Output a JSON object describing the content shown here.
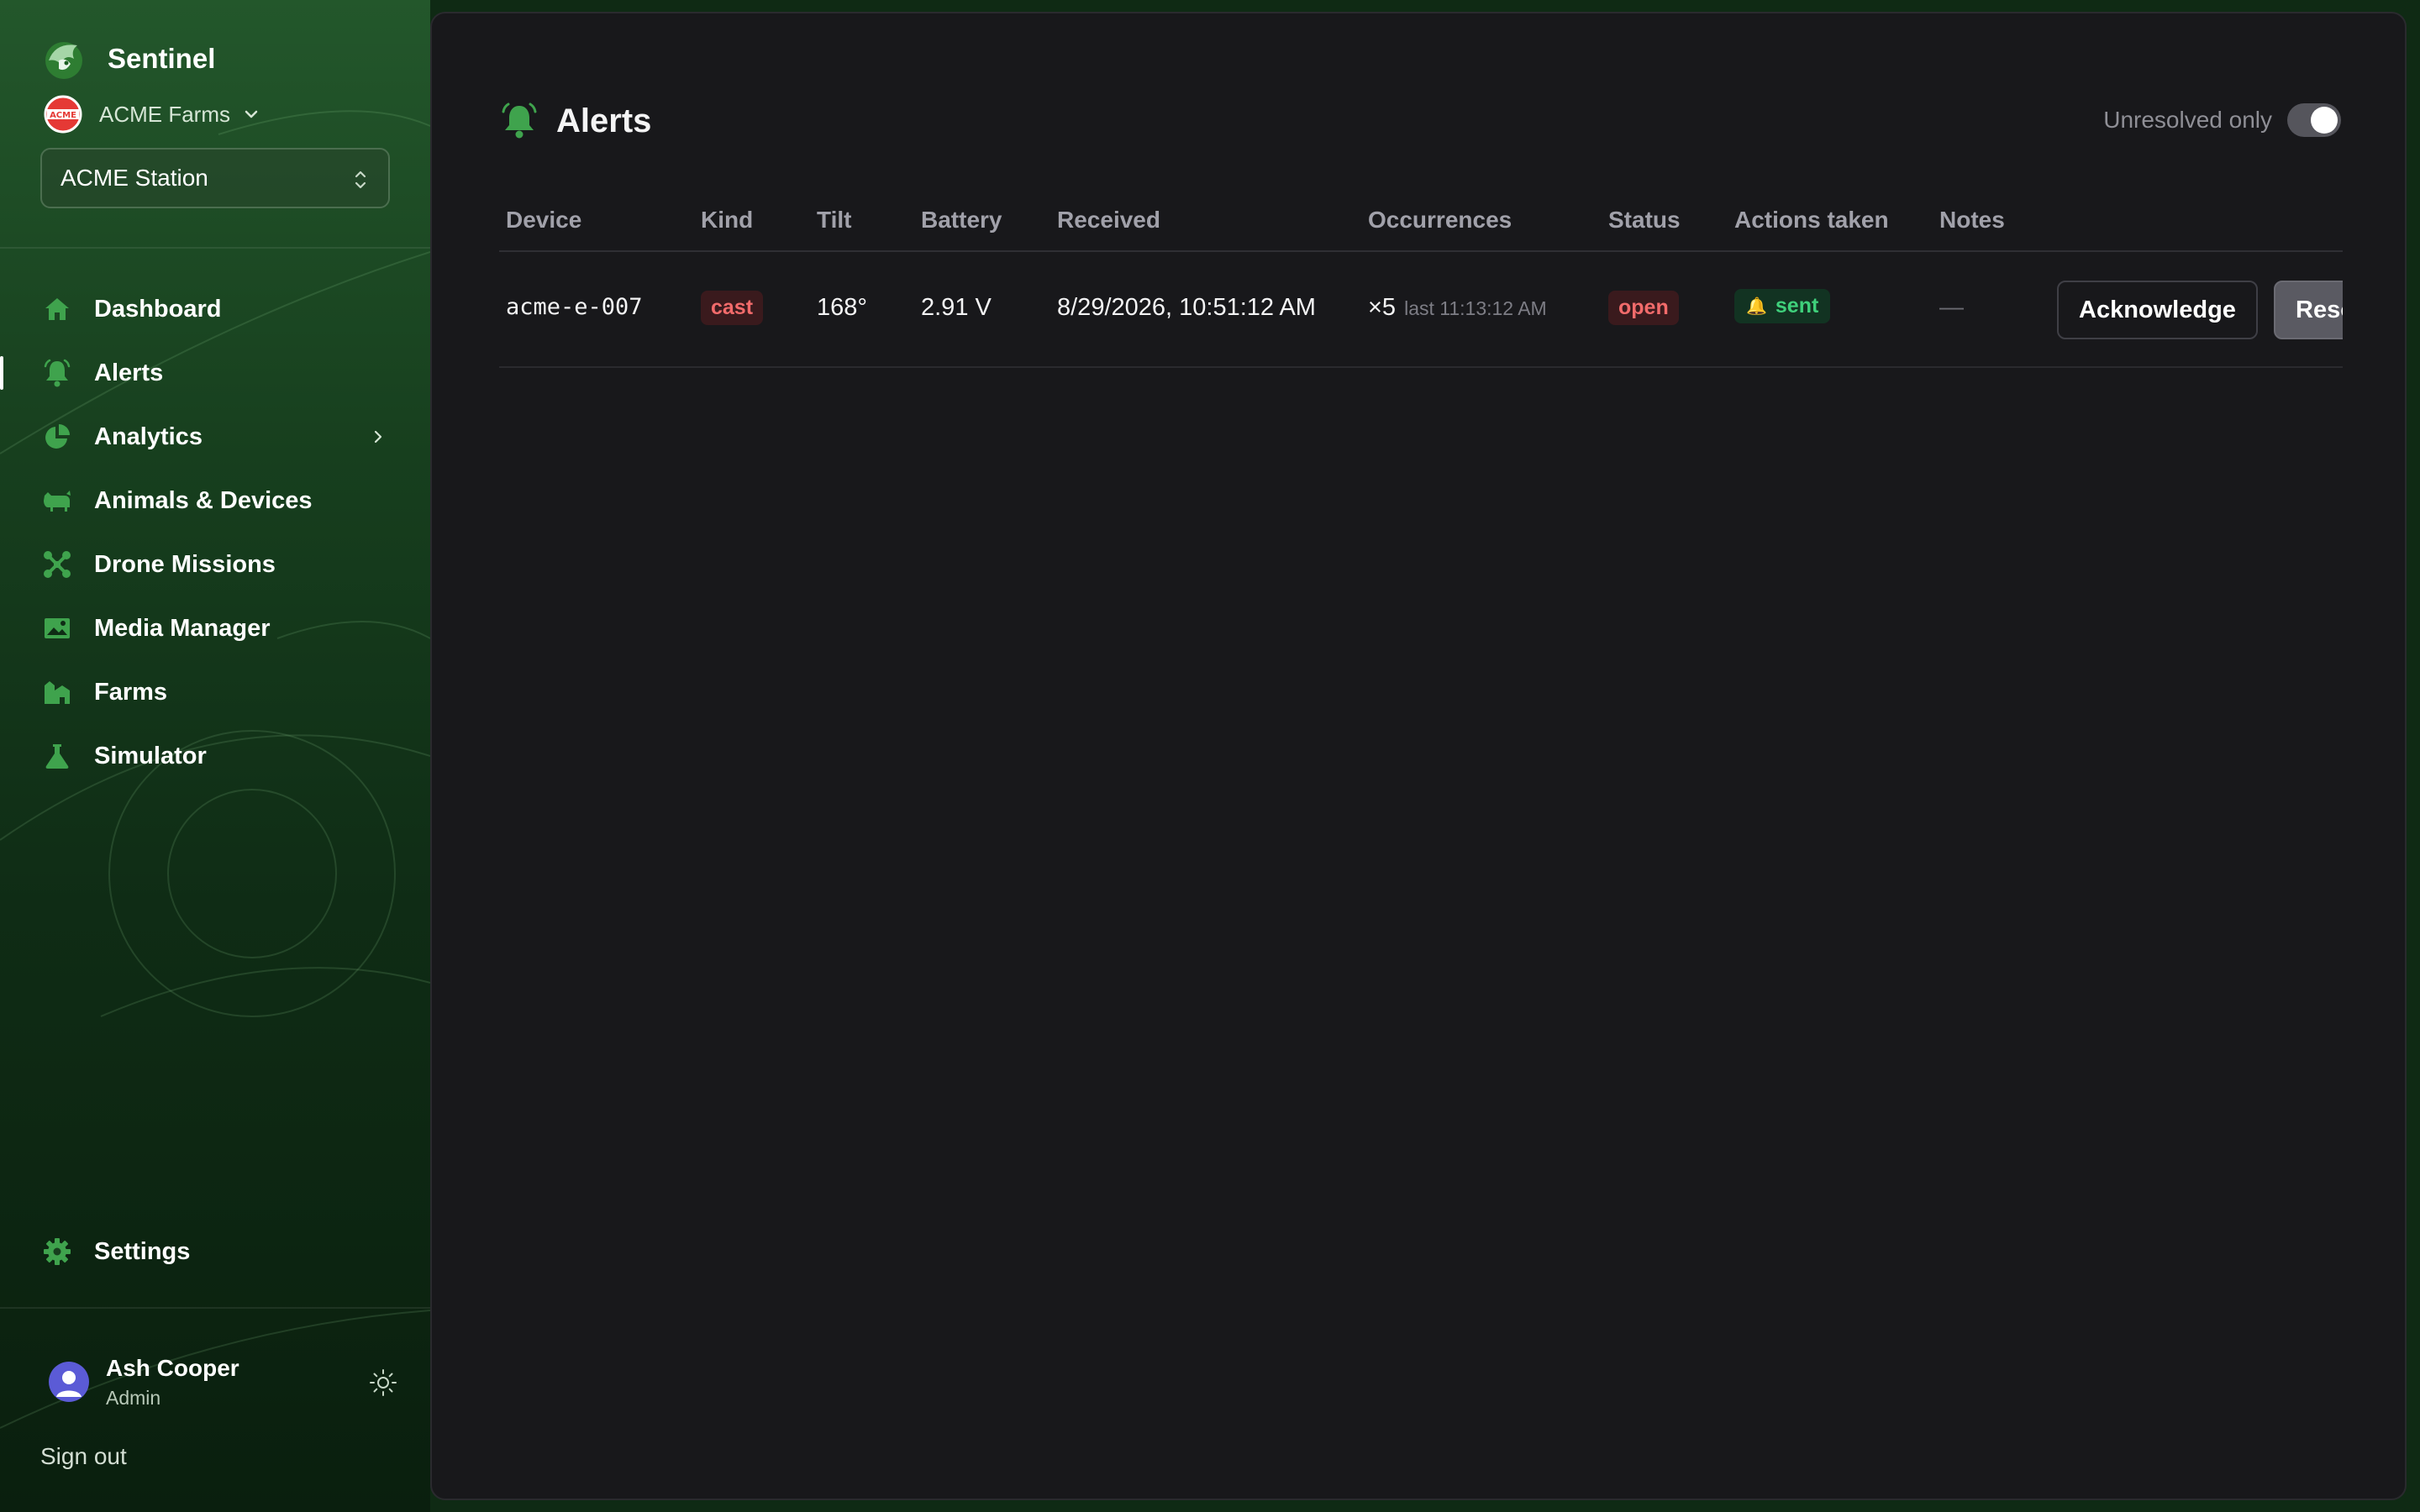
{
  "brand": {
    "name": "Sentinel"
  },
  "org": {
    "name": "ACME Farms",
    "logo_text": "ACME"
  },
  "station": {
    "selected": "ACME Station"
  },
  "nav": {
    "items": [
      {
        "label": "Dashboard",
        "icon": "home-icon"
      },
      {
        "label": "Alerts",
        "icon": "bell-icon",
        "active": true
      },
      {
        "label": "Analytics",
        "icon": "pie-chart-icon",
        "has_submenu": true
      },
      {
        "label": "Animals & Devices",
        "icon": "cow-icon"
      },
      {
        "label": "Drone Missions",
        "icon": "drone-icon"
      },
      {
        "label": "Media Manager",
        "icon": "image-icon"
      },
      {
        "label": "Farms",
        "icon": "farm-icon"
      },
      {
        "label": "Simulator",
        "icon": "flask-icon"
      }
    ],
    "settings": {
      "label": "Settings",
      "icon": "gear-icon"
    }
  },
  "user": {
    "name": "Ash Cooper",
    "role": "Admin"
  },
  "signout": "Sign out",
  "page": {
    "title": "Alerts",
    "filter_label": "Unresolved only",
    "filter_on": true
  },
  "table": {
    "columns": [
      "Device",
      "Kind",
      "Tilt",
      "Battery",
      "Received",
      "Occurrences",
      "Status",
      "Actions taken",
      "Notes"
    ],
    "rows": [
      {
        "device": "acme-e-007",
        "kind": "cast",
        "tilt": "168°",
        "battery": "2.91 V",
        "received": "8/29/2026, 10:51:12 AM",
        "occurrences": "×5",
        "occurrences_last": "last 11:13:12 AM",
        "status": "open",
        "actions_taken": "sent",
        "notes": "—",
        "acknowledge_label": "Acknowledge",
        "resolve_label": "Reso"
      }
    ]
  },
  "colors": {
    "accent_green": "#3fa34d",
    "sidebar_top": "#23572b",
    "panel_bg": "#18181b",
    "danger": "#f26b6b",
    "success": "#3fd07b"
  }
}
